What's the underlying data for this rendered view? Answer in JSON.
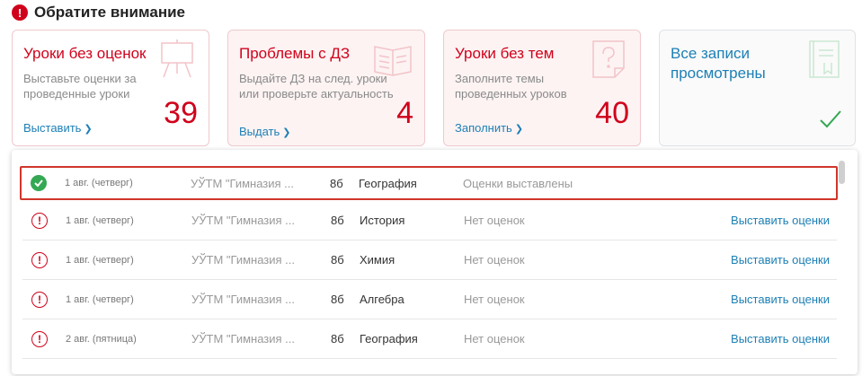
{
  "header": {
    "title": "Обратите внимание",
    "icon": "exclamation-icon"
  },
  "cards": [
    {
      "title": "Уроки без оценок",
      "desc": "Выставьте оценки за проведенные уроки",
      "link": "Выставить",
      "count": "39",
      "icon": "easel-icon"
    },
    {
      "title": "Проблемы с ДЗ",
      "desc": "Выдайте ДЗ на след. уроки или проверьте актуальность",
      "link": "Выдать",
      "count": "4",
      "icon": "open-book-icon"
    },
    {
      "title": "Уроки без тем",
      "desc": "Заполните темы проведенных уроков",
      "link": "Заполнить",
      "count": "40",
      "icon": "question-page-icon"
    },
    {
      "title": "Все записи просмотрены",
      "icon": "journal-icon",
      "status_icon": "checkmark-icon"
    }
  ],
  "rows": [
    {
      "date": "1 авг. (четверг)",
      "school": "УЎТМ \"Гимназия ...",
      "class": "8б",
      "subject": "География",
      "status": "Оценки выставлены",
      "action": "",
      "ok": true
    },
    {
      "date": "1 авг. (четверг)",
      "school": "УЎТМ \"Гимназия ...",
      "class": "8б",
      "subject": "История",
      "status": "Нет оценок",
      "action": "Выставить оценки",
      "ok": false
    },
    {
      "date": "1 авг. (четверг)",
      "school": "УЎТМ \"Гимназия ...",
      "class": "8б",
      "subject": "Химия",
      "status": "Нет оценок",
      "action": "Выставить оценки",
      "ok": false
    },
    {
      "date": "1 авг. (четверг)",
      "school": "УЎТМ \"Гимназия ...",
      "class": "8б",
      "subject": "Алгебра",
      "status": "Нет оценок",
      "action": "Выставить оценки",
      "ok": false
    },
    {
      "date": "2 авг. (пятница)",
      "school": "УЎТМ \"Гимназия ...",
      "class": "8б",
      "subject": "География",
      "status": "Нет оценок",
      "action": "Выставить оценки",
      "ok": false
    }
  ],
  "colors": {
    "accent_red": "#d0021b",
    "link_blue": "#1c7fb5",
    "ok_green": "#34a853"
  }
}
